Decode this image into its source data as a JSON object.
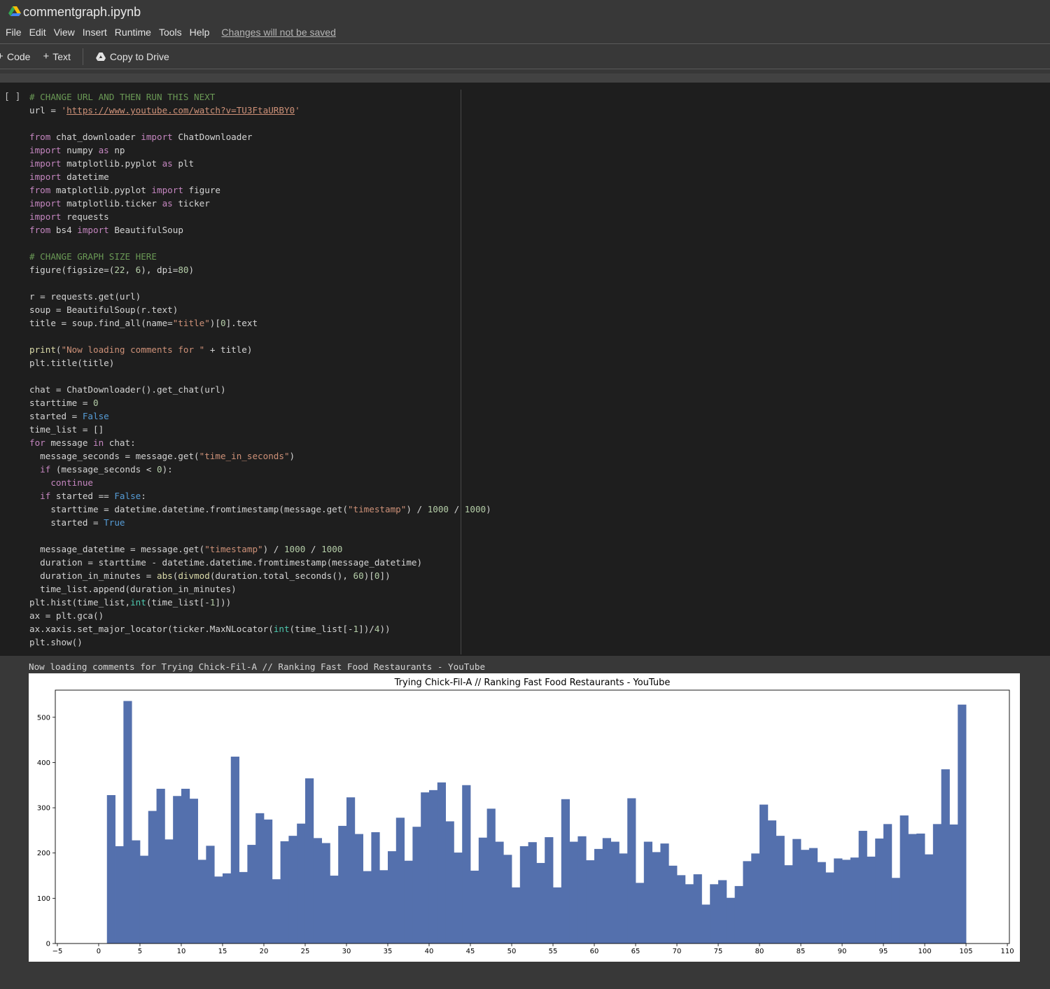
{
  "notebook": {
    "title": "commentgraph.ipynb"
  },
  "menu": {
    "items": [
      "File",
      "Edit",
      "View",
      "Insert",
      "Runtime",
      "Tools",
      "Help"
    ],
    "changes_notice": "Changes will not be saved"
  },
  "toolbar": {
    "code_label": "Code",
    "text_label": "Text",
    "copy_label": "Copy to Drive"
  },
  "cell": {
    "run_indicator": "[ ]",
    "code_lines": [
      [
        [
          "c",
          "# CHANGE URL AND THEN RUN THIS NEXT"
        ]
      ],
      [
        [
          "",
          "url = "
        ],
        [
          "s",
          "'"
        ],
        [
          "url",
          "https://www.youtube.com/watch?v=TU3FtaURBY0"
        ],
        [
          "s",
          "'"
        ]
      ],
      [],
      [
        [
          "k",
          "from"
        ],
        [
          "",
          " chat_downloader "
        ],
        [
          "k",
          "import"
        ],
        [
          "",
          " ChatDownloader"
        ]
      ],
      [
        [
          "k",
          "import"
        ],
        [
          "",
          " numpy "
        ],
        [
          "k",
          "as"
        ],
        [
          "",
          " np"
        ]
      ],
      [
        [
          "k",
          "import"
        ],
        [
          "",
          " matplotlib.pyplot "
        ],
        [
          "k",
          "as"
        ],
        [
          "",
          " plt"
        ]
      ],
      [
        [
          "k",
          "import"
        ],
        [
          "",
          " datetime"
        ]
      ],
      [
        [
          "k",
          "from"
        ],
        [
          "",
          " matplotlib.pyplot "
        ],
        [
          "k",
          "import"
        ],
        [
          "",
          " figure"
        ]
      ],
      [
        [
          "k",
          "import"
        ],
        [
          "",
          " matplotlib.ticker "
        ],
        [
          "k",
          "as"
        ],
        [
          "",
          " ticker"
        ]
      ],
      [
        [
          "k",
          "import"
        ],
        [
          "",
          " requests"
        ]
      ],
      [
        [
          "k",
          "from"
        ],
        [
          "",
          " bs4 "
        ],
        [
          "k",
          "import"
        ],
        [
          "",
          " BeautifulSoup"
        ]
      ],
      [],
      [
        [
          "c",
          "# CHANGE GRAPH SIZE HERE"
        ]
      ],
      [
        [
          "",
          "figure(figsize=("
        ],
        [
          "n",
          "22"
        ],
        [
          "",
          ", "
        ],
        [
          "n",
          "6"
        ],
        [
          "",
          "), dpi="
        ],
        [
          "n",
          "80"
        ],
        [
          "",
          ")"
        ]
      ],
      [],
      [
        [
          "",
          "r = requests.get(url)"
        ]
      ],
      [
        [
          "",
          "soup = BeautifulSoup(r.text)"
        ]
      ],
      [
        [
          "",
          "title = soup.find_all(name="
        ],
        [
          "s",
          "\"title\""
        ],
        [
          "",
          ")["
        ],
        [
          "n",
          "0"
        ],
        [
          "",
          "].text"
        ]
      ],
      [],
      [
        [
          "f",
          "print"
        ],
        [
          "",
          "("
        ],
        [
          "s",
          "\"Now loading comments for \""
        ],
        [
          "",
          " + title)"
        ]
      ],
      [
        [
          "",
          "plt.title(title)"
        ]
      ],
      [],
      [
        [
          "",
          "chat = ChatDownloader().get_chat(url)"
        ]
      ],
      [
        [
          "",
          "starttime = "
        ],
        [
          "n",
          "0"
        ]
      ],
      [
        [
          "",
          "started = "
        ],
        [
          "b",
          "False"
        ]
      ],
      [
        [
          "",
          "time_list = []"
        ]
      ],
      [
        [
          "k",
          "for"
        ],
        [
          "",
          " message "
        ],
        [
          "k",
          "in"
        ],
        [
          "",
          " chat:"
        ]
      ],
      [
        [
          "",
          "  message_seconds = message.get("
        ],
        [
          "s",
          "\"time_in_seconds\""
        ],
        [
          "",
          ")"
        ]
      ],
      [
        [
          "",
          "  "
        ],
        [
          "k",
          "if"
        ],
        [
          "",
          " (message_seconds < "
        ],
        [
          "n",
          "0"
        ],
        [
          "",
          "):"
        ]
      ],
      [
        [
          "",
          "    "
        ],
        [
          "k",
          "continue"
        ]
      ],
      [
        [
          "",
          "  "
        ],
        [
          "k",
          "if"
        ],
        [
          "",
          " started == "
        ],
        [
          "b",
          "False"
        ],
        [
          "",
          ":"
        ]
      ],
      [
        [
          "",
          "    starttime = datetime.datetime.fromtimestamp(message.get("
        ],
        [
          "s",
          "\"timestamp\""
        ],
        [
          "",
          ") / "
        ],
        [
          "n",
          "1000"
        ],
        [
          "",
          " / "
        ],
        [
          "n",
          "1000"
        ],
        [
          "",
          ")"
        ]
      ],
      [
        [
          "",
          "    started = "
        ],
        [
          "b",
          "True"
        ]
      ],
      [],
      [
        [
          "",
          "  message_datetime = message.get("
        ],
        [
          "s",
          "\"timestamp\""
        ],
        [
          "",
          ") / "
        ],
        [
          "n",
          "1000"
        ],
        [
          "",
          " / "
        ],
        [
          "n",
          "1000"
        ]
      ],
      [
        [
          "",
          "  duration = starttime - datetime.datetime.fromtimestamp(message_datetime)"
        ]
      ],
      [
        [
          "",
          "  duration_in_minutes = "
        ],
        [
          "f",
          "abs"
        ],
        [
          "",
          "("
        ],
        [
          "f",
          "divmod"
        ],
        [
          "",
          "(duration.total_seconds(), "
        ],
        [
          "n",
          "60"
        ],
        [
          "",
          ")["
        ],
        [
          "n",
          "0"
        ],
        [
          "",
          "])"
        ]
      ],
      [
        [
          "",
          "  time_list.append(duration_in_minutes)"
        ]
      ],
      [
        [
          "",
          "plt.hist(time_list,"
        ],
        [
          "bi",
          "int"
        ],
        [
          "",
          "(time_list[-"
        ],
        [
          "n",
          "1"
        ],
        [
          "",
          "]))"
        ]
      ],
      [
        [
          "",
          "ax = plt.gca()"
        ]
      ],
      [
        [
          "",
          "ax.xaxis.set_major_locator(ticker.MaxNLocator("
        ],
        [
          "bi",
          "int"
        ],
        [
          "",
          "(time_list[-"
        ],
        [
          "n",
          "1"
        ],
        [
          "",
          "])/"
        ],
        [
          "n",
          "4"
        ],
        [
          "",
          "))"
        ]
      ],
      [
        [
          "",
          "plt.show()"
        ]
      ]
    ]
  },
  "output": {
    "stdout": "Now loading comments for Trying Chick-Fil-A // Ranking Fast Food Restaurants - YouTube"
  },
  "chart_data": {
    "type": "bar",
    "title": "Trying Chick-Fil-A // Ranking Fast Food Restaurants - YouTube",
    "xlabel": "",
    "ylabel": "",
    "xlim": [
      -5.25,
      110.25
    ],
    "ylim": [
      0,
      560
    ],
    "x_ticks": [
      -5,
      0,
      5,
      10,
      15,
      20,
      25,
      30,
      35,
      40,
      45,
      50,
      55,
      60,
      65,
      70,
      75,
      80,
      85,
      90,
      95,
      100,
      105,
      110
    ],
    "y_ticks": [
      0,
      100,
      200,
      300,
      400,
      500
    ],
    "bin_start": 1,
    "bin_end": 105,
    "bar_color": "#5470ad",
    "values": [
      328,
      215,
      536,
      228,
      194,
      293,
      342,
      230,
      326,
      342,
      320,
      185,
      216,
      148,
      155,
      413,
      158,
      218,
      288,
      274,
      142,
      226,
      238,
      265,
      365,
      233,
      222,
      150,
      260,
      323,
      242,
      160,
      246,
      162,
      204,
      278,
      183,
      258,
      334,
      339,
      356,
      270,
      201,
      350,
      161,
      234,
      298,
      225,
      196,
      124,
      215,
      224,
      178,
      235,
      124,
      319,
      225,
      237,
      184,
      209,
      233,
      225,
      199,
      321,
      134,
      225,
      202,
      221,
      172,
      151,
      131,
      153,
      86,
      131,
      140,
      101,
      127,
      182,
      199,
      307,
      272,
      238,
      173,
      231,
      207,
      211,
      180,
      157,
      188,
      185,
      190,
      249,
      192,
      232,
      264,
      145,
      283,
      242,
      243,
      197,
      264,
      385,
      263,
      528
    ]
  }
}
